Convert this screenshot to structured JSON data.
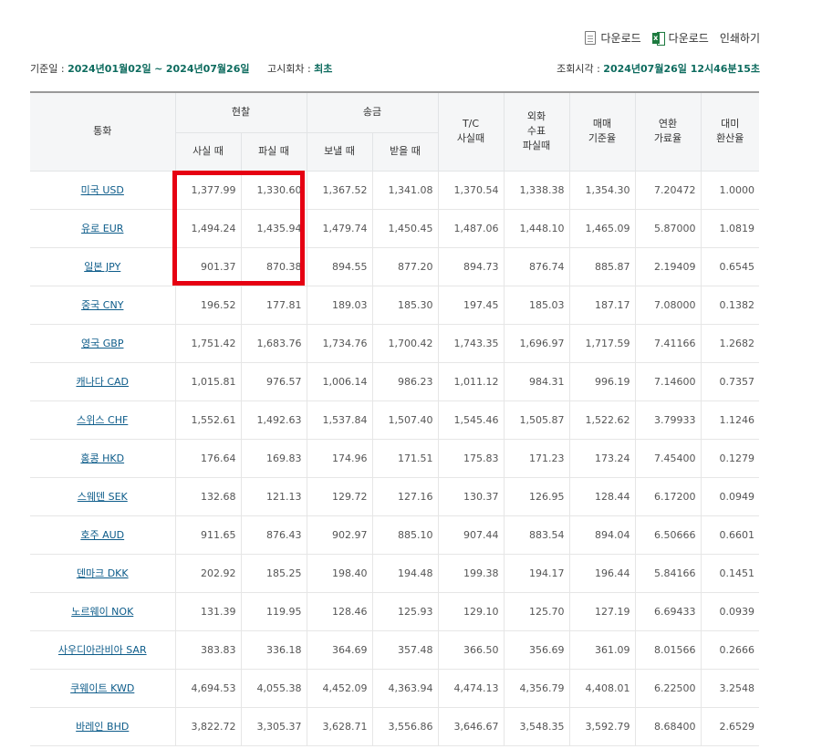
{
  "toolbar": {
    "download1": "다운로드",
    "download2": "다운로드",
    "print": "인쇄하기"
  },
  "meta": {
    "base_date_label": "기준일 : ",
    "start_date": "2024년01월02일",
    "range_sep": "~",
    "end_date": "2024년07월26일",
    "notice_label": "고시회차 : ",
    "notice_value": "최초",
    "query_label": "조회시각 : ",
    "query_time": "2024년07월26일 12시46분15초"
  },
  "headers": {
    "currency": "통화",
    "cash": "현찰",
    "cash_buy": "사실 때",
    "cash_sell": "파실 때",
    "remit": "송금",
    "remit_send": "보낼 때",
    "remit_receive": "받을 때",
    "tc": "T/C\n사실때",
    "cheque": "외화\n수표\n파실때",
    "base_rate": "매매\n기준율",
    "conversion": "연환\n가료율",
    "usd_conversion": "대미\n환산율"
  },
  "highlight": {
    "color": "#e60012",
    "rows": [
      "USD",
      "EUR",
      "JPY"
    ],
    "columns": [
      "cash_buy",
      "cash_sell"
    ]
  },
  "rows": [
    {
      "currency": "미국 USD",
      "cash_buy": "1,377.99",
      "cash_sell": "1,330.60",
      "send": "1,367.52",
      "receive": "1,341.08",
      "tc": "1,370.54",
      "cheque": "1,338.38",
      "base": "1,354.30",
      "conv": "7.20472",
      "usd": "1.0000"
    },
    {
      "currency": "유로 EUR",
      "cash_buy": "1,494.24",
      "cash_sell": "1,435.94",
      "send": "1,479.74",
      "receive": "1,450.45",
      "tc": "1,487.06",
      "cheque": "1,448.10",
      "base": "1,465.09",
      "conv": "5.87000",
      "usd": "1.0819"
    },
    {
      "currency": "일본 JPY",
      "cash_buy": "901.37",
      "cash_sell": "870.38",
      "send": "894.55",
      "receive": "877.20",
      "tc": "894.73",
      "cheque": "876.74",
      "base": "885.87",
      "conv": "2.19409",
      "usd": "0.6545"
    },
    {
      "currency": "중국 CNY",
      "cash_buy": "196.52",
      "cash_sell": "177.81",
      "send": "189.03",
      "receive": "185.30",
      "tc": "197.45",
      "cheque": "185.03",
      "base": "187.17",
      "conv": "7.08000",
      "usd": "0.1382"
    },
    {
      "currency": "영국 GBP",
      "cash_buy": "1,751.42",
      "cash_sell": "1,683.76",
      "send": "1,734.76",
      "receive": "1,700.42",
      "tc": "1,743.35",
      "cheque": "1,696.97",
      "base": "1,717.59",
      "conv": "7.41166",
      "usd": "1.2682"
    },
    {
      "currency": "캐나다 CAD",
      "cash_buy": "1,015.81",
      "cash_sell": "976.57",
      "send": "1,006.14",
      "receive": "986.23",
      "tc": "1,011.12",
      "cheque": "984.31",
      "base": "996.19",
      "conv": "7.14600",
      "usd": "0.7357"
    },
    {
      "currency": "스위스 CHF",
      "cash_buy": "1,552.61",
      "cash_sell": "1,492.63",
      "send": "1,537.84",
      "receive": "1,507.40",
      "tc": "1,545.46",
      "cheque": "1,505.87",
      "base": "1,522.62",
      "conv": "3.79933",
      "usd": "1.1246"
    },
    {
      "currency": "홍콩 HKD",
      "cash_buy": "176.64",
      "cash_sell": "169.83",
      "send": "174.96",
      "receive": "171.51",
      "tc": "175.83",
      "cheque": "171.23",
      "base": "173.24",
      "conv": "7.45400",
      "usd": "0.1279"
    },
    {
      "currency": "스웨덴 SEK",
      "cash_buy": "132.68",
      "cash_sell": "121.13",
      "send": "129.72",
      "receive": "127.16",
      "tc": "130.37",
      "cheque": "126.95",
      "base": "128.44",
      "conv": "6.17200",
      "usd": "0.0949"
    },
    {
      "currency": "호주 AUD",
      "cash_buy": "911.65",
      "cash_sell": "876.43",
      "send": "902.97",
      "receive": "885.10",
      "tc": "907.44",
      "cheque": "883.54",
      "base": "894.04",
      "conv": "6.50666",
      "usd": "0.6601"
    },
    {
      "currency": "덴마크 DKK",
      "cash_buy": "202.92",
      "cash_sell": "185.25",
      "send": "198.40",
      "receive": "194.48",
      "tc": "199.38",
      "cheque": "194.17",
      "base": "196.44",
      "conv": "5.84166",
      "usd": "0.1451"
    },
    {
      "currency": "노르웨이 NOK",
      "cash_buy": "131.39",
      "cash_sell": "119.95",
      "send": "128.46",
      "receive": "125.93",
      "tc": "129.10",
      "cheque": "125.70",
      "base": "127.19",
      "conv": "6.69433",
      "usd": "0.0939"
    },
    {
      "currency": "사우디아라비아 SAR",
      "cash_buy": "383.83",
      "cash_sell": "336.18",
      "send": "364.69",
      "receive": "357.48",
      "tc": "366.50",
      "cheque": "356.69",
      "base": "361.09",
      "conv": "8.01566",
      "usd": "0.2666"
    },
    {
      "currency": "쿠웨이트 KWD",
      "cash_buy": "4,694.53",
      "cash_sell": "4,055.38",
      "send": "4,452.09",
      "receive": "4,363.94",
      "tc": "4,474.13",
      "cheque": "4,356.79",
      "base": "4,408.01",
      "conv": "6.22500",
      "usd": "3.2548"
    },
    {
      "currency": "바레인 BHD",
      "cash_buy": "3,822.72",
      "cash_sell": "3,305.37",
      "send": "3,628.71",
      "receive": "3,556.86",
      "tc": "3,646.67",
      "cheque": "3,548.35",
      "base": "3,592.79",
      "conv": "8.68400",
      "usd": "2.6529"
    }
  ]
}
